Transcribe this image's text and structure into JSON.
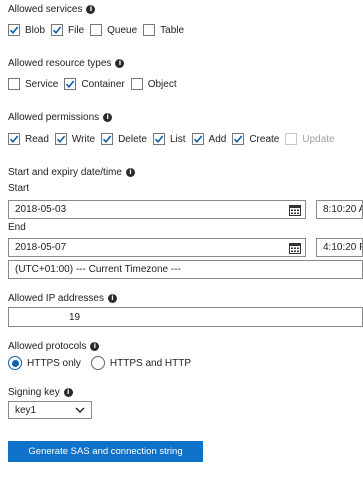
{
  "services": {
    "heading": "Allowed services",
    "options": [
      {
        "label": "Blob",
        "checked": true
      },
      {
        "label": "File",
        "checked": true
      },
      {
        "label": "Queue",
        "checked": false
      },
      {
        "label": "Table",
        "checked": false
      }
    ]
  },
  "resource_types": {
    "heading": "Allowed resource types",
    "options": [
      {
        "label": "Service",
        "checked": false
      },
      {
        "label": "Container",
        "checked": true
      },
      {
        "label": "Object",
        "checked": false
      }
    ]
  },
  "permissions": {
    "heading": "Allowed permissions",
    "options": [
      {
        "label": "Read",
        "checked": true
      },
      {
        "label": "Write",
        "checked": true
      },
      {
        "label": "Delete",
        "checked": true
      },
      {
        "label": "List",
        "checked": true
      },
      {
        "label": "Add",
        "checked": true
      },
      {
        "label": "Create",
        "checked": true
      },
      {
        "label": "Update",
        "checked": false,
        "disabled": true
      }
    ]
  },
  "expiry": {
    "heading": "Start and expiry date/time",
    "start_label": "Start",
    "start_date": "2018-05-03",
    "start_time": "8:10:20 A",
    "end_label": "End",
    "end_date": "2018-05-07",
    "end_time": "4:10:20 P",
    "timezone": "(UTC+01:00) --- Current Timezone ---"
  },
  "ip": {
    "heading": "Allowed IP addresses",
    "value": "19"
  },
  "protocols": {
    "heading": "Allowed protocols",
    "options": [
      {
        "label": "HTTPS only",
        "selected": true
      },
      {
        "label": "HTTPS and HTTP",
        "selected": false
      }
    ]
  },
  "signing": {
    "heading": "Signing key",
    "value": "key1"
  },
  "generate_button": "Generate SAS and connection string",
  "colors": {
    "accent": "#0f72c8",
    "check": "#0f5fa8"
  }
}
